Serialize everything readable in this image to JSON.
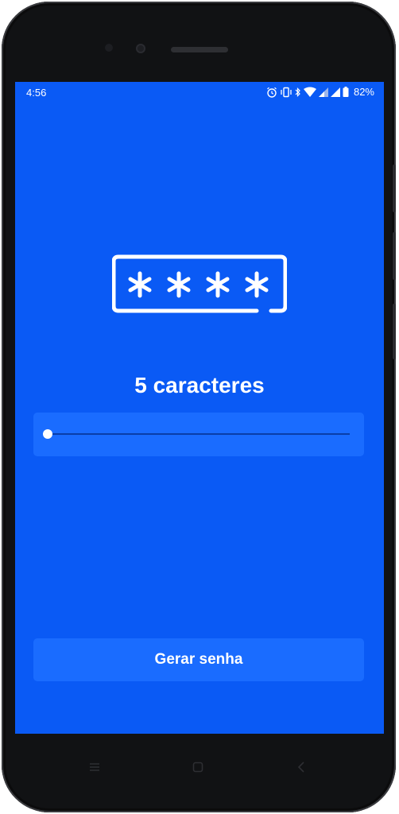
{
  "status_bar": {
    "time": "4:56",
    "battery_percent": "82%",
    "icons": [
      "alarm-icon",
      "vibrate-icon",
      "bluetooth-icon",
      "wifi-icon",
      "signal-icon",
      "signal-icon",
      "battery-icon"
    ]
  },
  "password_icon": {
    "symbols": "****"
  },
  "length": {
    "label": "5 caracteres",
    "value_fraction": 0.0
  },
  "actions": {
    "generate_label": "Gerar senha"
  },
  "navigation": {
    "icons": [
      "menu-icon",
      "home-icon",
      "back-icon"
    ]
  },
  "colors": {
    "background": "#0a5af5",
    "card": "#1a6cff",
    "text": "#ffffff"
  }
}
